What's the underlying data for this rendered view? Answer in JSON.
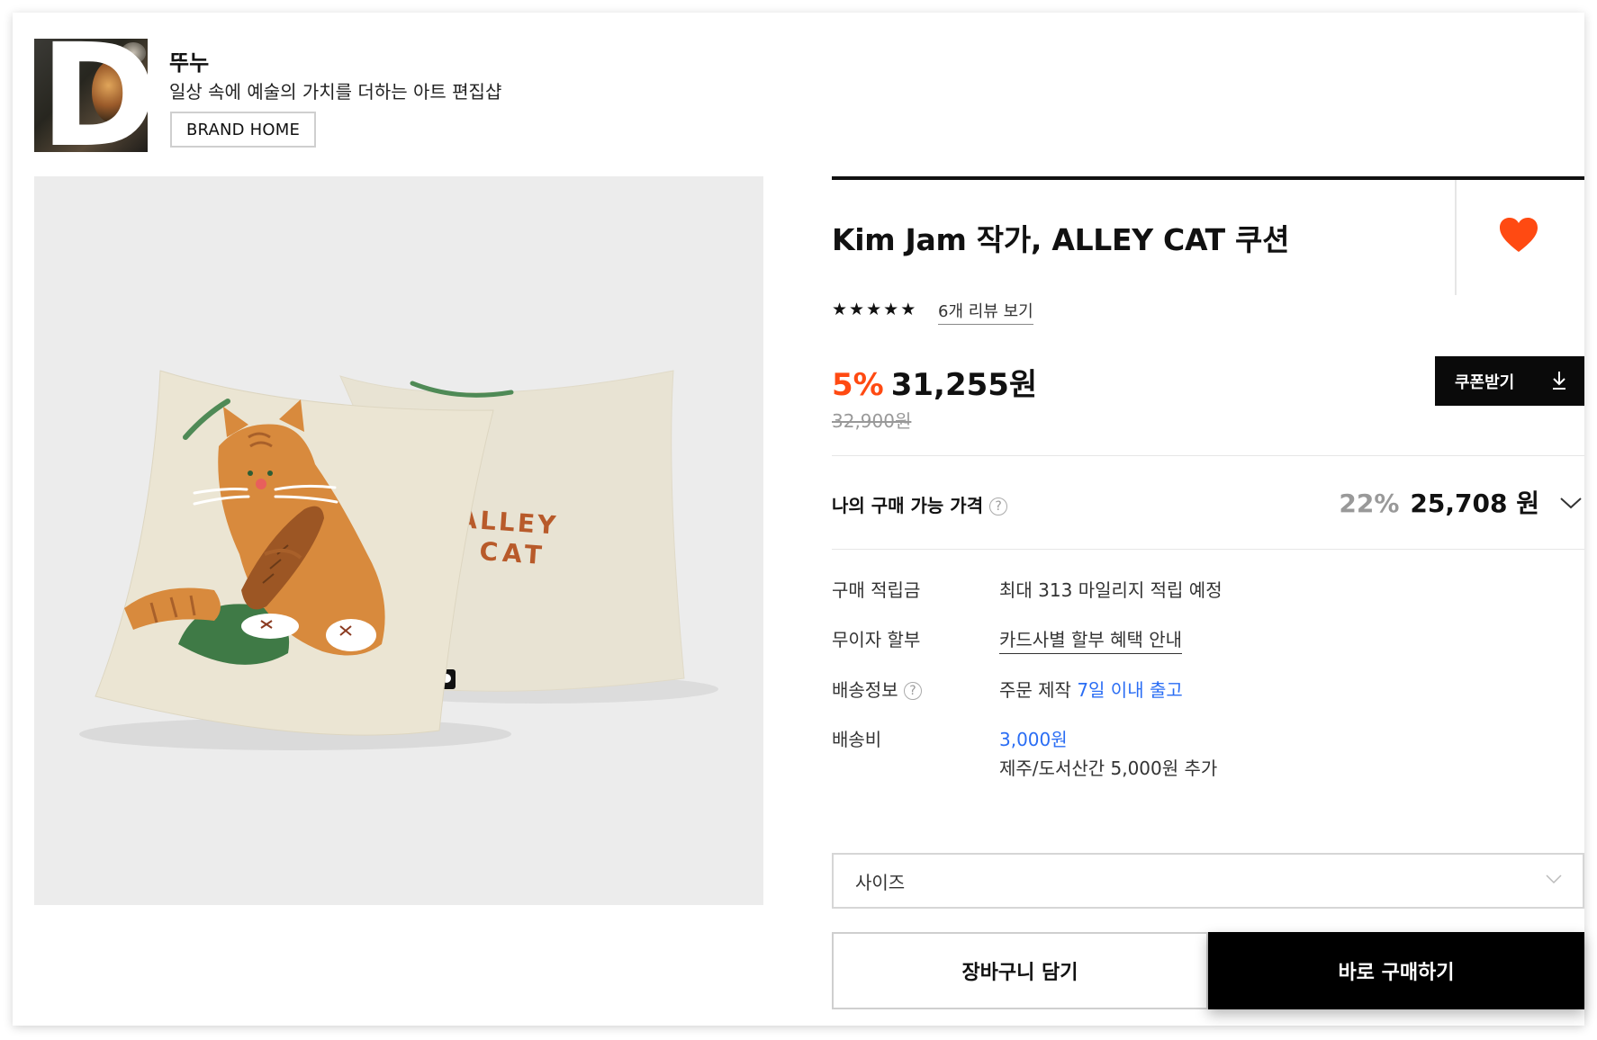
{
  "brand": {
    "logo_letter": "D",
    "name": "뚜누",
    "description": "일상 속에 예술의 가치를 더하는 아트 편집샵",
    "home_button": "BRAND HOME"
  },
  "product": {
    "title": "Kim Jam 작가, ALLEY CAT 쿠션",
    "image_text_line1": "ALLEY",
    "image_text_line2": "CAT",
    "rating_stars": 5,
    "review_link": "6개 리뷰 보기",
    "discount": "5%",
    "price": "31,255원",
    "original_price": "32,900원",
    "coupon_button": "쿠폰받기"
  },
  "my_price": {
    "label": "나의 구매 가능 가격",
    "help": "?",
    "discount": "22%",
    "amount": "25,708",
    "unit": "원"
  },
  "info": {
    "points_label": "구매 적립금",
    "points_value": "최대 313 마일리지 적립 예정",
    "installment_label": "무이자 할부",
    "installment_value": "카드사별 할부 혜택 안내",
    "shipping_label": "배송정보",
    "shipping_help": "?",
    "shipping_prefix": "주문 제작",
    "shipping_highlight": "7일 이내 출고",
    "fee_label": "배송비",
    "fee_value": "3,000원",
    "fee_extra": "제주/도서산간 5,000원 추가"
  },
  "options": {
    "size_placeholder": "사이즈"
  },
  "actions": {
    "cart": "장바구니 담기",
    "buy": "바로 구매하기"
  },
  "colors": {
    "accent": "#ff4a12",
    "heart": "#ff4a12",
    "link_blue": "#2a6df4",
    "button_dark": "#000000"
  }
}
